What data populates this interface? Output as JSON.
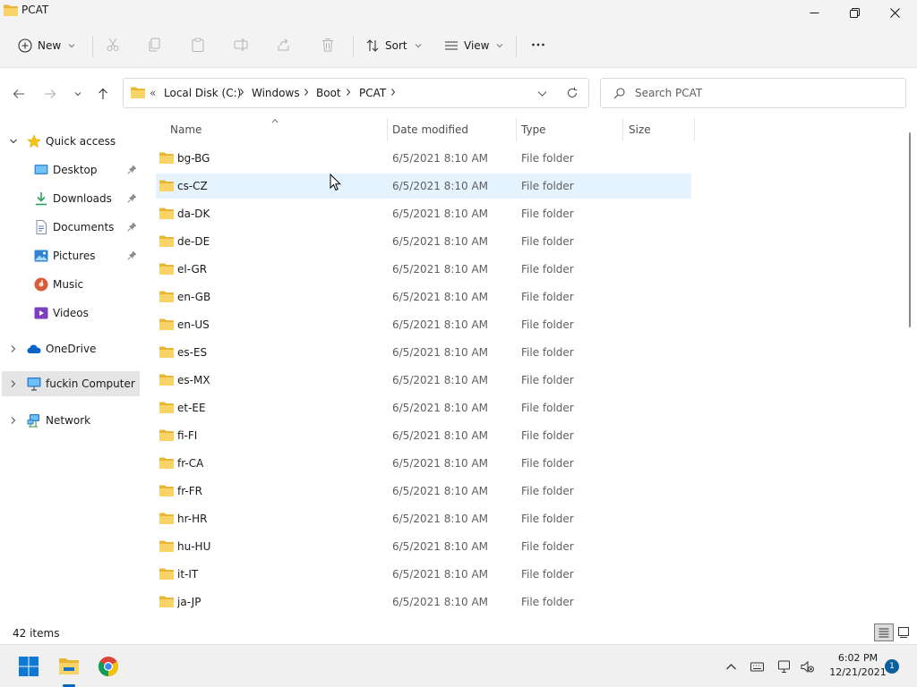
{
  "window": {
    "title": "PCAT",
    "controls": [
      "minimize",
      "maximize",
      "close"
    ]
  },
  "toolbar": {
    "new_label": "New",
    "sort_label": "Sort",
    "view_label": "View",
    "icons": [
      "cut-icon",
      "copy-icon",
      "paste-icon",
      "rename-icon",
      "share-icon",
      "delete-icon",
      "more-icon"
    ]
  },
  "address": {
    "overflow": "«",
    "crumbs": [
      "Local Disk (C:)",
      "Windows",
      "Boot",
      "PCAT"
    ]
  },
  "search": {
    "placeholder": "Search PCAT"
  },
  "sidebar": {
    "quick_access": "Quick access",
    "items": [
      {
        "label": "Desktop",
        "icon": "desktop-icon",
        "pinned": true
      },
      {
        "label": "Downloads",
        "icon": "downloads-icon",
        "pinned": true
      },
      {
        "label": "Documents",
        "icon": "documents-icon",
        "pinned": true
      },
      {
        "label": "Pictures",
        "icon": "pictures-icon",
        "pinned": true
      },
      {
        "label": "Music",
        "icon": "music-icon",
        "pinned": false
      },
      {
        "label": "Videos",
        "icon": "videos-icon",
        "pinned": false
      }
    ],
    "onedrive": "OneDrive",
    "computer": "fuckin Computer",
    "network": "Network"
  },
  "columns": {
    "name": "Name",
    "date": "Date modified",
    "type": "Type",
    "size": "Size"
  },
  "files": [
    {
      "name": "bg-BG",
      "date": "6/5/2021 8:10 AM",
      "type": "File folder"
    },
    {
      "name": "cs-CZ",
      "date": "6/5/2021 8:10 AM",
      "type": "File folder"
    },
    {
      "name": "da-DK",
      "date": "6/5/2021 8:10 AM",
      "type": "File folder"
    },
    {
      "name": "de-DE",
      "date": "6/5/2021 8:10 AM",
      "type": "File folder"
    },
    {
      "name": "el-GR",
      "date": "6/5/2021 8:10 AM",
      "type": "File folder"
    },
    {
      "name": "en-GB",
      "date": "6/5/2021 8:10 AM",
      "type": "File folder"
    },
    {
      "name": "en-US",
      "date": "6/5/2021 8:10 AM",
      "type": "File folder"
    },
    {
      "name": "es-ES",
      "date": "6/5/2021 8:10 AM",
      "type": "File folder"
    },
    {
      "name": "es-MX",
      "date": "6/5/2021 8:10 AM",
      "type": "File folder"
    },
    {
      "name": "et-EE",
      "date": "6/5/2021 8:10 AM",
      "type": "File folder"
    },
    {
      "name": "fi-FI",
      "date": "6/5/2021 8:10 AM",
      "type": "File folder"
    },
    {
      "name": "fr-CA",
      "date": "6/5/2021 8:10 AM",
      "type": "File folder"
    },
    {
      "name": "fr-FR",
      "date": "6/5/2021 8:10 AM",
      "type": "File folder"
    },
    {
      "name": "hr-HR",
      "date": "6/5/2021 8:10 AM",
      "type": "File folder"
    },
    {
      "name": "hu-HU",
      "date": "6/5/2021 8:10 AM",
      "type": "File folder"
    },
    {
      "name": "it-IT",
      "date": "6/5/2021 8:10 AM",
      "type": "File folder"
    },
    {
      "name": "ja-JP",
      "date": "6/5/2021 8:10 AM",
      "type": "File folder"
    }
  ],
  "hovered_file": "cs-CZ",
  "status": {
    "item_count": "42 items"
  },
  "taskbar": {
    "apps": [
      "start-icon",
      "file-explorer-icon",
      "chrome-icon"
    ],
    "time": "6:02 PM",
    "date": "12/21/2021",
    "notifications": "1"
  },
  "colors": {
    "folder": "#f0c543",
    "hover_row": "#e5f3ff",
    "accent": "#0067c0"
  }
}
